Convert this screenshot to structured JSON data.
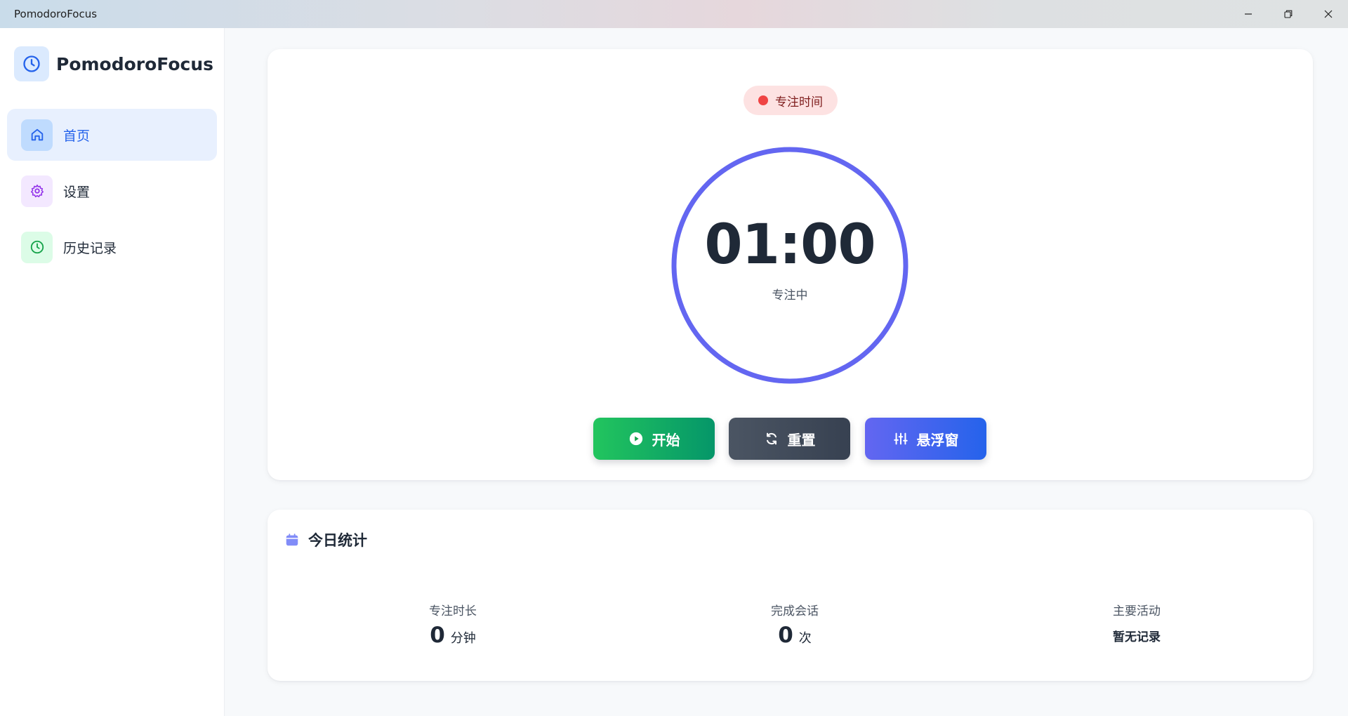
{
  "window": {
    "title": "PomodoroFocus"
  },
  "sidebar": {
    "brand": "PomodoroFocus",
    "items": [
      {
        "label": "首页",
        "icon": "home-icon",
        "active": true,
        "color": "#2563eb"
      },
      {
        "label": "设置",
        "icon": "gear-icon",
        "active": false,
        "color": "#9333ea"
      },
      {
        "label": "历史记录",
        "icon": "clock-icon",
        "active": false,
        "color": "#16a34a"
      }
    ]
  },
  "timer": {
    "mode_label": "专注时间",
    "time": "01:00",
    "status": "专注中",
    "progress": 1.0,
    "ring_color": "#6366f1"
  },
  "controls": {
    "start_label": "开始",
    "reset_label": "重置",
    "float_label": "悬浮窗"
  },
  "stats": {
    "title": "今日统计",
    "focus_duration": {
      "label": "专注时长",
      "value": "0",
      "unit": "分钟"
    },
    "sessions": {
      "label": "完成会话",
      "value": "0",
      "unit": "次"
    },
    "main_activity": {
      "label": "主要活动",
      "value": "暂无记录"
    }
  }
}
